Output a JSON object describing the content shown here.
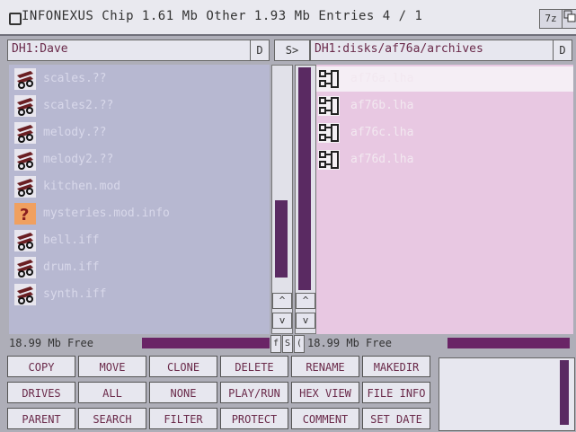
{
  "window": {
    "title": "INFONEXUS Chip 1.61 Mb Other 1.93 Mb Entries 4 / 1",
    "zoom_label": "7z"
  },
  "left_panel": {
    "path": "DH1:Dave",
    "device_button": "D",
    "free": "18.99 Mb Free",
    "files": [
      {
        "name": "scales.??",
        "icon": "sound-file-icon"
      },
      {
        "name": "scales2.??",
        "icon": "sound-file-icon"
      },
      {
        "name": "melody.??",
        "icon": "sound-file-icon"
      },
      {
        "name": "melody2.??",
        "icon": "sound-file-icon"
      },
      {
        "name": "kitchen.mod",
        "icon": "sound-file-icon"
      },
      {
        "name": "mysteries.mod.info",
        "icon": "unknown-file-icon"
      },
      {
        "name": "bell.iff",
        "icon": "sound-file-icon"
      },
      {
        "name": "drum.iff",
        "icon": "sound-file-icon"
      },
      {
        "name": "synth.iff",
        "icon": "sound-file-icon"
      }
    ]
  },
  "middle": {
    "swap_button": "S>",
    "up_arrow": "^",
    "down_arrow": "v",
    "f_label": "f",
    "s_label": "S",
    "c_label": "("
  },
  "right_panel": {
    "path": "DH1:disks/af76a/archives",
    "device_button": "D",
    "free": "18.99 Mb Free",
    "files": [
      {
        "name": "af76a.lha",
        "icon": "archive-icon",
        "selected": true
      },
      {
        "name": "af76b.lha",
        "icon": "archive-icon",
        "selected": false
      },
      {
        "name": "af76c.lha",
        "icon": "archive-icon",
        "selected": false
      },
      {
        "name": "af76d.lha",
        "icon": "archive-icon",
        "selected": false
      }
    ]
  },
  "buttons": [
    [
      "COPY",
      "MOVE",
      "CLONE",
      "DELETE",
      "RENAME",
      "MAKEDIR"
    ],
    [
      "DRIVES",
      "ALL",
      "NONE",
      "PLAY/RUN",
      "HEX VIEW",
      "FILE INFO"
    ],
    [
      "PARENT",
      "SEARCH",
      "FILTER",
      "PROTECT",
      "COMMENT",
      "SET DATE"
    ]
  ],
  "colors": {
    "left_pane_bg": "#b7b8d1",
    "right_pane_bg": "#e8c8e2",
    "scroll_knob": "#5a2a62",
    "button_text": "#6a2a4a"
  }
}
